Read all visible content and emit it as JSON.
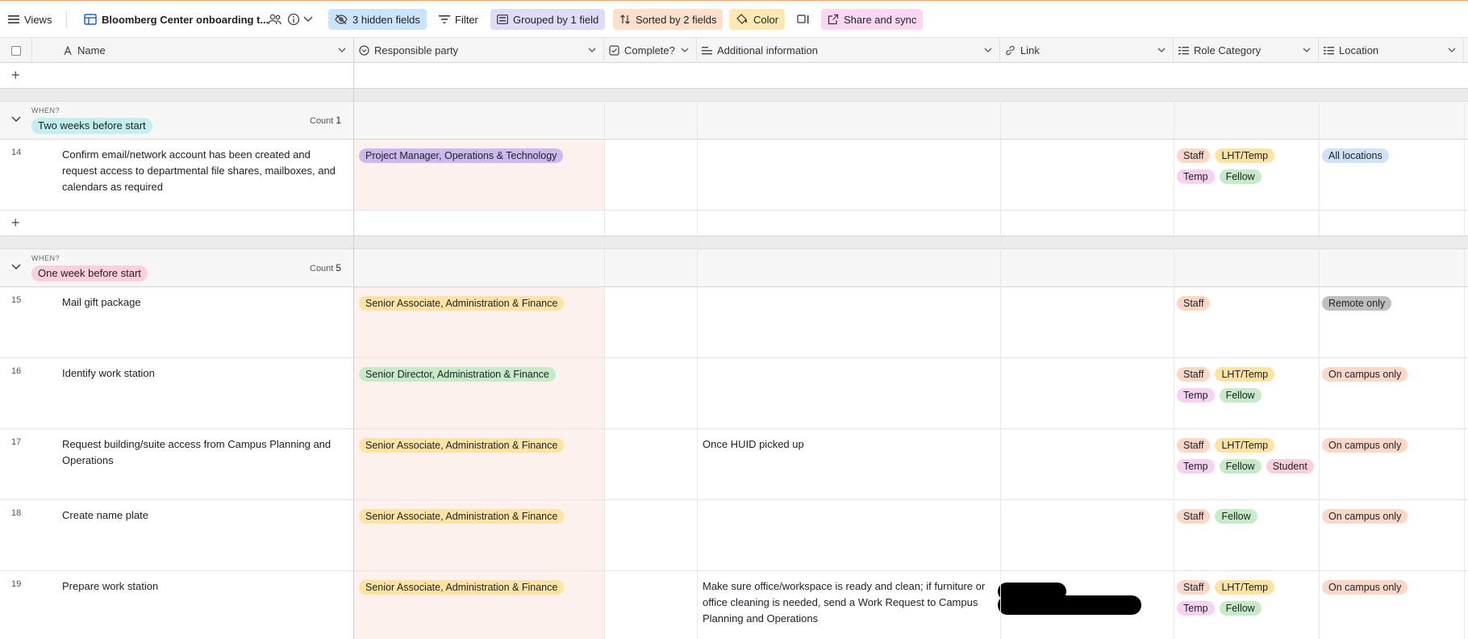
{
  "toolbar": {
    "views_label": "Views",
    "table_name": "Bloomberg Center onboarding t...",
    "hidden_fields": "3 hidden fields",
    "filter": "Filter",
    "grouped": "Grouped by 1 field",
    "sorted": "Sorted by 2 fields",
    "color": "Color",
    "share": "Share and sync"
  },
  "columns": {
    "name": "Name",
    "responsible": "Responsible party",
    "complete": "Complete?",
    "additional": "Additional information",
    "link": "Link",
    "role": "Role Category",
    "location": "Location"
  },
  "group_when_label": "WHEN?",
  "count_label": "Count",
  "groups": [
    {
      "title": "Two weeks before start",
      "count": "1",
      "rows": [
        {
          "num": "14",
          "name": "Confirm email/network account has been created and request access to departmental file shares, mailboxes, and calendars as required",
          "responsible": "Project Manager, Operations & Technology",
          "info": "",
          "roles": [
            "Staff",
            "LHT/Temp",
            "Temp",
            "Fellow"
          ],
          "location": "All locations"
        }
      ]
    },
    {
      "title": "One week before start",
      "count": "5",
      "rows": [
        {
          "num": "15",
          "name": "Mail gift package",
          "responsible": "Senior Associate, Administration & Finance",
          "info": "",
          "roles": [
            "Staff"
          ],
          "location": "Remote only"
        },
        {
          "num": "16",
          "name": "Identify work station",
          "responsible": "Senior Director, Administration & Finance",
          "info": "",
          "roles": [
            "Staff",
            "LHT/Temp",
            "Temp",
            "Fellow"
          ],
          "location": "On campus only"
        },
        {
          "num": "17",
          "name": "Request building/suite access from Campus Planning and Operations",
          "responsible": "Senior Associate, Administration & Finance",
          "info": "Once HUID picked up",
          "roles": [
            "Staff",
            "LHT/Temp",
            "Temp",
            "Fellow",
            "Student"
          ],
          "location": "On campus only"
        },
        {
          "num": "18",
          "name": "Create name plate",
          "responsible": "Senior Associate, Administration & Finance",
          "info": "",
          "roles": [
            "Staff",
            "Fellow"
          ],
          "location": "On campus only"
        },
        {
          "num": "19",
          "name": "Prepare work station",
          "responsible": "Senior Associate, Administration & Finance",
          "info": "Make sure office/workspace is ready and clean; if furniture or office cleaning is needed, send a Work Request to Campus Planning and Operations",
          "roles": [
            "Staff",
            "LHT/Temp",
            "Temp",
            "Fellow"
          ],
          "location": "On campus only"
        }
      ]
    }
  ],
  "colors": {
    "group_two_weeks": "#c2f0ec",
    "group_one_week": "#fbd0dc",
    "toolbar_accent": "#e8a26a"
  }
}
